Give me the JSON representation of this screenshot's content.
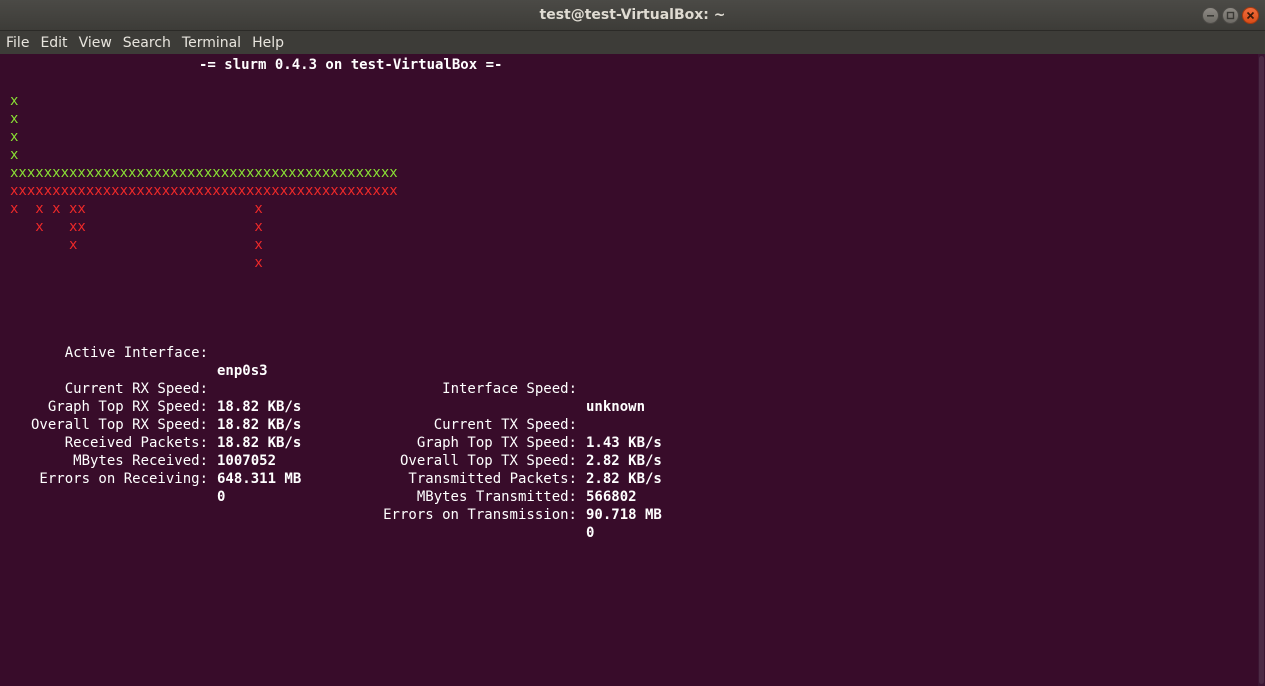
{
  "window": {
    "title": "test@test-VirtualBox: ~"
  },
  "menu": [
    "File",
    "Edit",
    "View",
    "Search",
    "Terminal",
    "Help"
  ],
  "terminal": {
    "header": "-= slurm 0.4.3 on test-VirtualBox =-",
    "graph": {
      "rx_rows": [
        "x",
        "x",
        "x",
        "x",
        "xxxxxxxxxxxxxxxxxxxxxxxxxxxxxxxxxxxxxxxxxxxxxx"
      ],
      "tx_rows": [
        "xxxxxxxxxxxxxxxxxxxxxxxxxxxxxxxxxxxxxxxxxxxxxx",
        "x  x x xx                    x",
        "   x   xx                    x",
        "       x                     x",
        "                             x"
      ]
    },
    "stats_left": [
      {
        "label": "Active Interface:",
        "value": "enp0s3"
      },
      {
        "label": "",
        "value": ""
      },
      {
        "label": "Current RX Speed:",
        "value": "18.82 KB/s"
      },
      {
        "label": "Graph Top RX Speed:",
        "value": "18.82 KB/s"
      },
      {
        "label": "Overall Top RX Speed:",
        "value": "18.82 KB/s"
      },
      {
        "label": "Received Packets:",
        "value": "1007052"
      },
      {
        "label": "MBytes Received:",
        "value": "648.311 MB"
      },
      {
        "label": "Errors on Receiving:",
        "value": "0"
      }
    ],
    "stats_right": [
      {
        "label": "Interface Speed:",
        "value": "unknown"
      },
      {
        "label": "",
        "value": ""
      },
      {
        "label": "Current TX Speed:",
        "value": "1.43 KB/s"
      },
      {
        "label": "Graph Top TX Speed:",
        "value": "2.82 KB/s"
      },
      {
        "label": "Overall Top TX Speed:",
        "value": "2.82 KB/s"
      },
      {
        "label": "Transmitted Packets:",
        "value": "566802"
      },
      {
        "label": "MBytes Transmitted:",
        "value": "90.718 MB"
      },
      {
        "label": "Errors on Transmission:",
        "value": "0"
      }
    ]
  },
  "colors": {
    "terminal_bg": "#380c2a",
    "rx_graph": "#8ae234",
    "tx_graph": "#ef2929",
    "close_button": "#e95420"
  }
}
